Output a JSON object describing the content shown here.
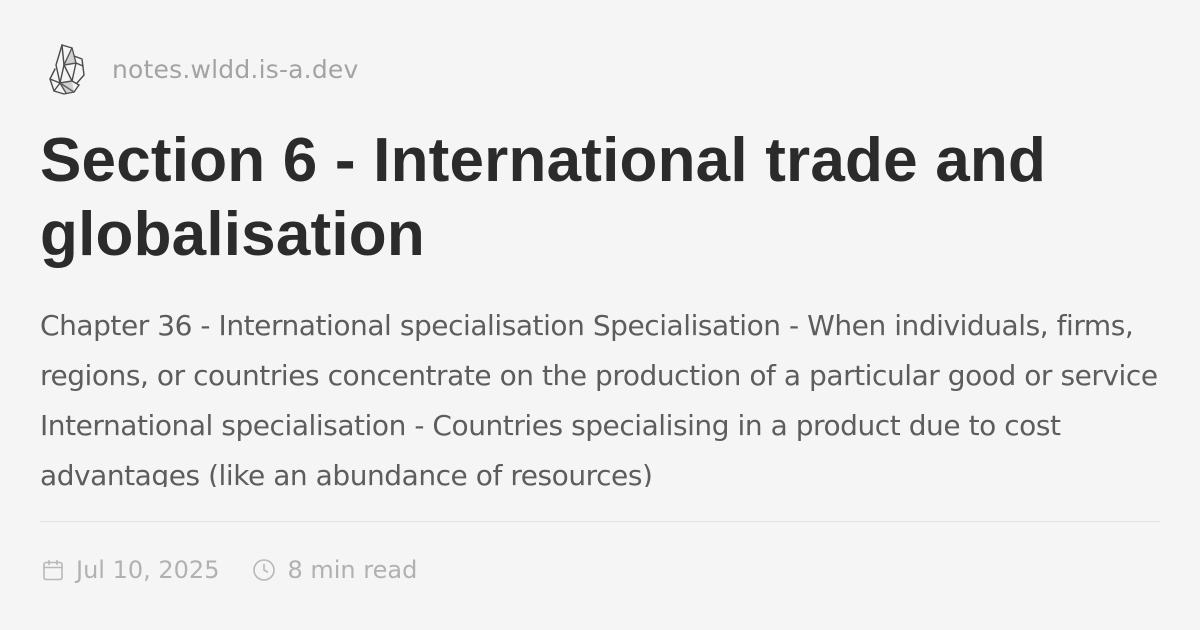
{
  "site": {
    "name": "notes.wldd.is-a.dev",
    "logo_icon": "crystal-cluster-icon"
  },
  "post": {
    "title": "Section 6 - International trade and globalisation",
    "excerpt": "Chapter 36 - International specialisation Specialisation - When individuals, firms, regions, or countries concentrate on the production of a particular good or service International specialisation - Countries specialising in a product due to cost advantages (like an abundance of resources)"
  },
  "meta": {
    "date": "Jul 10, 2025",
    "date_icon": "calendar-icon",
    "read_time": "8 min read",
    "read_time_icon": "clock-icon"
  },
  "colors": {
    "background": "#f6f5f5",
    "title": "#2b2b2b",
    "excerpt": "#5d5d5d",
    "muted": "#b1b1b1"
  }
}
